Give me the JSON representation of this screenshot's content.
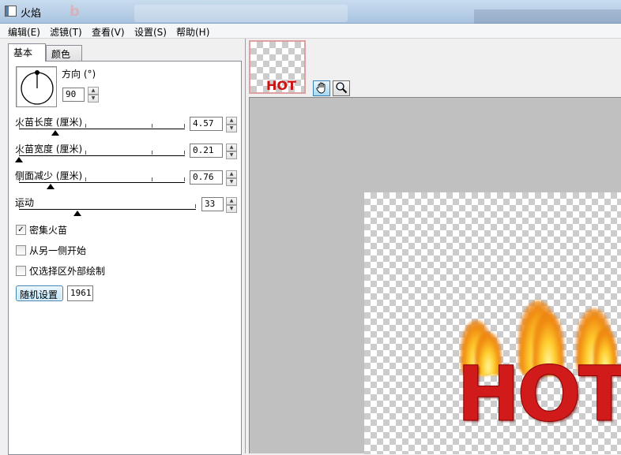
{
  "window": {
    "title": "火焰"
  },
  "menu": {
    "items": [
      {
        "label": "编辑(E)"
      },
      {
        "label": "滤镜(T)"
      },
      {
        "label": "查看(V)"
      },
      {
        "label": "设置(S)"
      },
      {
        "label": "帮助(H)"
      }
    ]
  },
  "tabs": {
    "basic": "基本",
    "color": "颜色"
  },
  "direction": {
    "label": "方向 (°)",
    "value": "90"
  },
  "sliders": {
    "flame_length": {
      "label": "火苗长度 (厘米)",
      "value": "4.57",
      "level": 0.22
    },
    "flame_width": {
      "label": "火苗宽度 (厘米)",
      "value": "0.21",
      "level": 0.0
    },
    "side_reduce": {
      "label": "侧面减少 (厘米)",
      "value": "0.76",
      "level": 0.19
    },
    "motion": {
      "label": "运动",
      "value": "33",
      "level": 0.33
    }
  },
  "options": {
    "dense_flame": {
      "label": "密集火苗",
      "checked": true
    },
    "from_other_side": {
      "label": "从另一侧开始",
      "checked": false
    },
    "only_outside_selection": {
      "label": "仅选择区外部绘制",
      "checked": false
    }
  },
  "random": {
    "button_label": "随机设置",
    "seed": "1961"
  },
  "preview": {
    "thumb_text": "HOT",
    "canvas_text": "HOT"
  },
  "icons": {
    "hand_tool": "hand-icon",
    "zoom_tool": "magnifier-icon"
  }
}
